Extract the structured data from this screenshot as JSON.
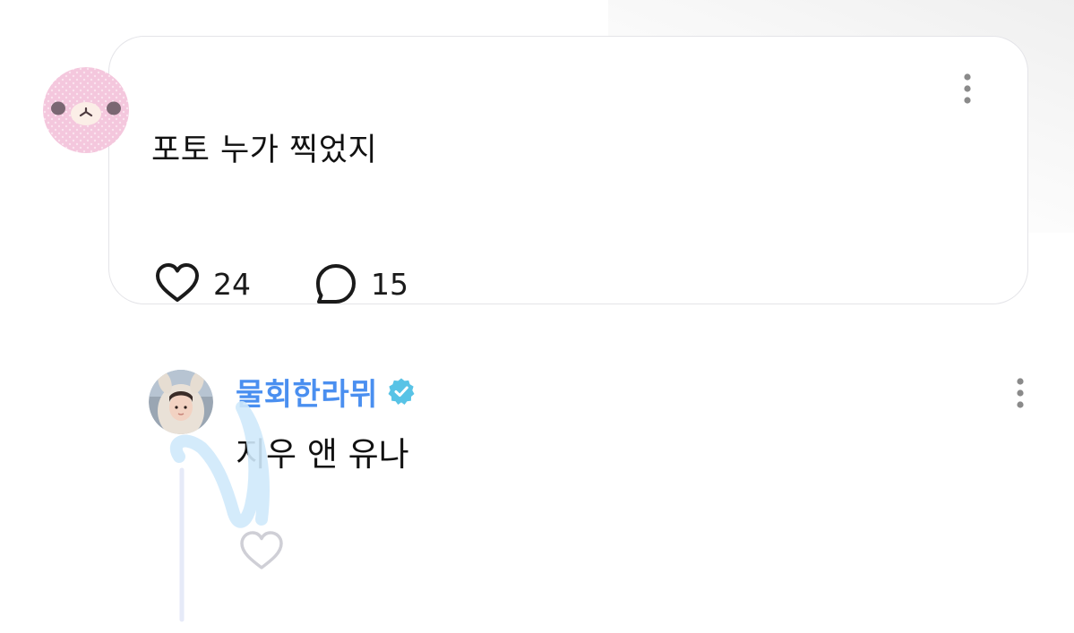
{
  "quoted_post": {
    "text": "포토 누가 찍었지",
    "likes": "24",
    "comments": "15",
    "avatar_icon": "pink-bear-avatar",
    "more_icon": "more-vertical-icon"
  },
  "reply": {
    "username": "물회한라뮈",
    "verified": true,
    "text": "지우 앤 유나",
    "avatar_icon": "user-avatar-photo",
    "more_icon": "more-vertical-icon"
  },
  "colors": {
    "username": "#4a8ff0",
    "verified_badge": "#58c3e6",
    "scribble": "#cfe9fb",
    "card_border": "#e4e4e8"
  }
}
